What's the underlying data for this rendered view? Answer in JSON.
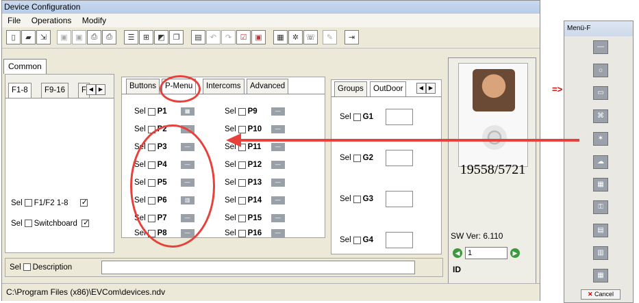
{
  "window": {
    "title": "Device Configuration"
  },
  "menu": {
    "file": "File",
    "operations": "Operations",
    "modify": "Modify"
  },
  "toolbar_icons": [
    "new-icon",
    "open-icon",
    "import-icon",
    "save-icon",
    "save-all-icon",
    "print-preview-icon",
    "print-icon",
    "export-icon",
    "tree-icon",
    "window-icon",
    "copy-icon",
    "table-icon",
    "undo-icon",
    "redo-icon",
    "check-icon",
    "stop-icon",
    "grid-icon",
    "wizard-icon",
    "phone-icon",
    "pen-icon",
    "exit-icon"
  ],
  "outer_tab": "Common",
  "left_tabs": [
    "F1-8",
    "F9-16",
    "F"
  ],
  "left_rows": [
    {
      "sel": "Sel",
      "label": "F1/F2 1-8",
      "checked": true
    },
    {
      "sel": "Sel",
      "label": "Switchboard",
      "checked": true
    }
  ],
  "inner_tabs": [
    "Buttons",
    "P-Menu",
    "Intercoms",
    "Advanced"
  ],
  "pmenu_left": [
    {
      "sel": "Sel",
      "name": "P1"
    },
    {
      "sel": "Sel",
      "name": "P2"
    },
    {
      "sel": "Sel",
      "name": "P3"
    },
    {
      "sel": "Sel",
      "name": "P4"
    },
    {
      "sel": "Sel",
      "name": "P5"
    },
    {
      "sel": "Sel",
      "name": "P6"
    },
    {
      "sel": "Sel",
      "name": "P7"
    },
    {
      "sel": "Sel",
      "name": "P8"
    }
  ],
  "pmenu_right": [
    {
      "sel": "Sel",
      "name": "P9"
    },
    {
      "sel": "Sel",
      "name": "P10"
    },
    {
      "sel": "Sel",
      "name": "P11"
    },
    {
      "sel": "Sel",
      "name": "P12"
    },
    {
      "sel": "Sel",
      "name": "P13"
    },
    {
      "sel": "Sel",
      "name": "P14"
    },
    {
      "sel": "Sel",
      "name": "P15"
    },
    {
      "sel": "Sel",
      "name": "P16"
    }
  ],
  "group_tabs": [
    "Groups",
    "OutDoor"
  ],
  "groups": [
    {
      "sel": "Sel",
      "name": "G1"
    },
    {
      "sel": "Sel",
      "name": "G2"
    },
    {
      "sel": "Sel",
      "name": "G3"
    },
    {
      "sel": "Sel",
      "name": "G4"
    }
  ],
  "device": {
    "id_number": "19558/5721",
    "sw_version": "SW Ver: 6.110",
    "id_value": "1",
    "id_label": "ID"
  },
  "description": {
    "sel": "Sel",
    "label": "Description",
    "value": ""
  },
  "status_path": "C:\\Program Files (x86)\\EVCom\\devices.ndv",
  "side_panel": {
    "title": "Menü-F",
    "pointer": "=>",
    "cancel": "Cancel",
    "buttons": [
      "dash",
      "sun",
      "tv",
      "fan",
      "blind",
      "cloud",
      "grid",
      "key",
      "screen",
      "panel",
      "tower"
    ]
  },
  "accent": {
    "annotation_red": "#e8413b"
  }
}
